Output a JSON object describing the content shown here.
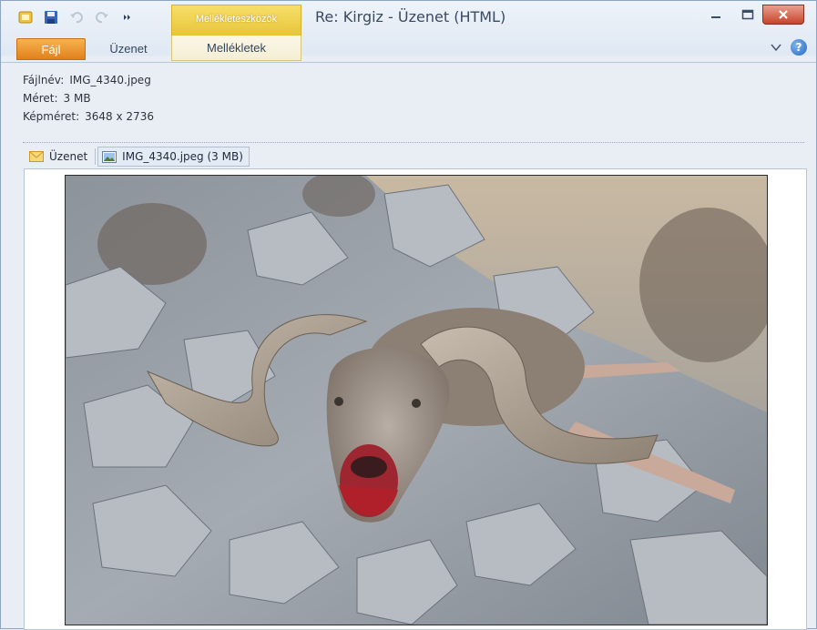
{
  "window": {
    "title": "Re: Kirgiz - Üzenet (HTML)",
    "context_tab_group": "Mellékleteszközök"
  },
  "ribbon": {
    "tabs": [
      {
        "label": "Fájl"
      },
      {
        "label": "Üzenet"
      },
      {
        "label": "Mellékletek"
      }
    ]
  },
  "attachment_info": {
    "filename_label": "Fájlnév:",
    "filename_value": "IMG_4340.jpeg",
    "size_label": "Méret:",
    "size_value": "3 MB",
    "dimensions_label": "Képméret:",
    "dimensions_value": "3648 x 2736"
  },
  "attachments": [
    {
      "label": "Üzenet",
      "icon": "envelope-icon"
    },
    {
      "label": "IMG_4340.jpeg (3 MB)",
      "icon": "image-file-icon"
    }
  ],
  "preview": {
    "image_alt": "IMG_4340.jpeg"
  },
  "colors": {
    "file_tab": "#e0801c",
    "context_tab": "#e8c43a",
    "close_button": "#c8442c",
    "help_icon": "#2567c2"
  }
}
